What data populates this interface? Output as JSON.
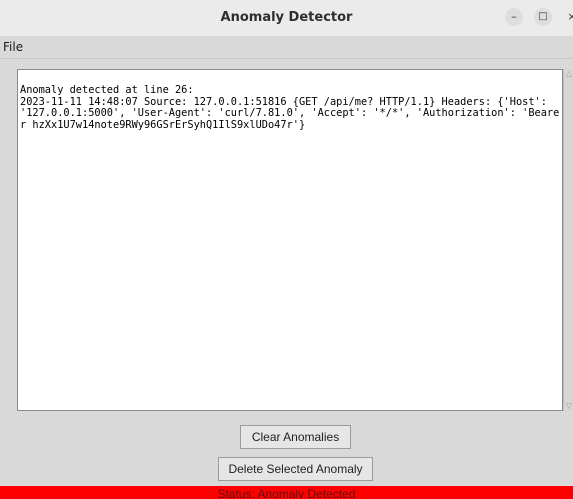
{
  "window": {
    "title": "Anomaly Detector",
    "controls": {
      "minimize": "–",
      "maximize": "□",
      "close": "×"
    }
  },
  "menubar": {
    "items": [
      {
        "label": "File"
      }
    ]
  },
  "log": {
    "text": "Anomaly detected at line 26:\n2023-11-11 14:48:07 Source: 127.0.0.1:51816 {GET /api/me? HTTP/1.1} Headers: {'Host': '127.0.0.1:5000', 'User-Agent': 'curl/7.81.0', 'Accept': '*/*', 'Authorization': 'Bearer hzXx1U7w14note9RWy96GSrErSyhQ1IlS9xlUDo47r'}"
  },
  "scrollbar": {
    "up_icon": "triangle-up",
    "down_icon": "triangle-down"
  },
  "buttons": {
    "clear": "Clear Anomalies",
    "delete": "Delete Selected Anomaly"
  },
  "status": {
    "text": "Status: Anomaly Detected",
    "color": "#ff0000"
  }
}
